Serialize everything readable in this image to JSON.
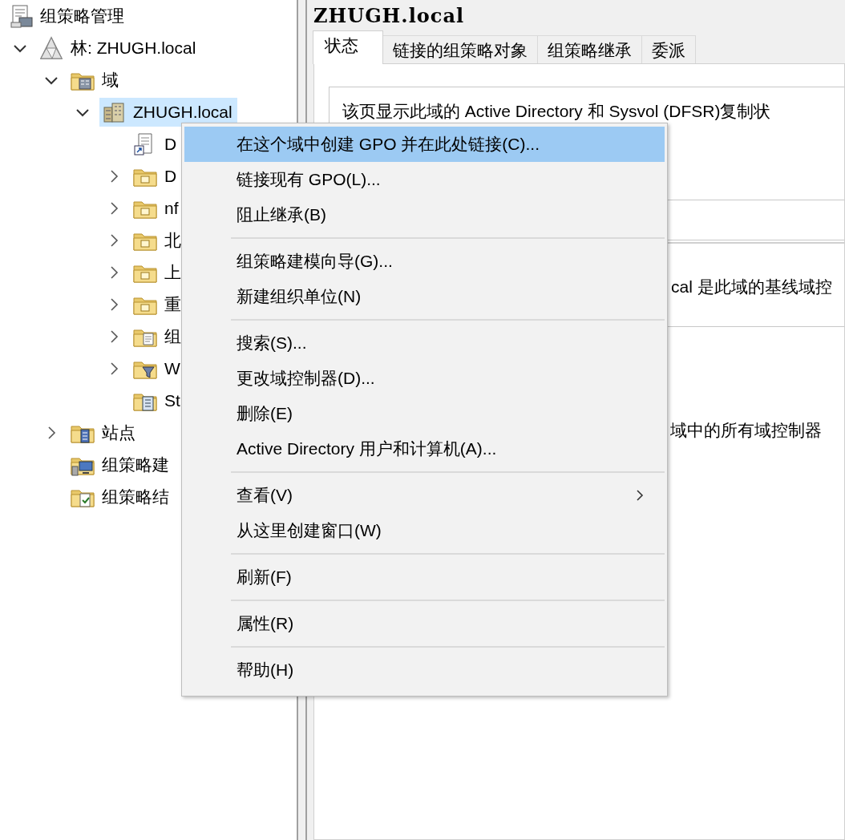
{
  "tree": [
    {
      "label": "组策略管理",
      "kind": "console",
      "selected": false,
      "children": [
        {
          "label": "林: ZHUGH.local",
          "kind": "forest",
          "expanded": true,
          "selected": false,
          "children": [
            {
              "label": "域",
              "kind": "domains",
              "expanded": true,
              "selected": false,
              "children": [
                {
                  "label": "ZHUGH.local",
                  "kind": "domain",
                  "expanded": true,
                  "selected": true,
                  "children": [
                    {
                      "label": "D",
                      "kind": "gpo-link",
                      "selected": false
                    },
                    {
                      "label": "D",
                      "kind": "ou",
                      "expanded": false,
                      "selected": false
                    },
                    {
                      "label": "nf",
                      "kind": "ou",
                      "expanded": false,
                      "selected": false
                    },
                    {
                      "label": "北",
                      "kind": "ou",
                      "expanded": false,
                      "selected": false
                    },
                    {
                      "label": "上",
                      "kind": "ou",
                      "expanded": false,
                      "selected": false
                    },
                    {
                      "label": "重",
                      "kind": "ou",
                      "expanded": false,
                      "selected": false
                    },
                    {
                      "label": "组",
                      "kind": "gpo-folder",
                      "expanded": false,
                      "selected": false
                    },
                    {
                      "label": "W",
                      "kind": "filter-folder",
                      "expanded": false,
                      "selected": false
                    },
                    {
                      "label": "St",
                      "kind": "starter-folder",
                      "selected": false
                    }
                  ]
                }
              ]
            },
            {
              "label": "站点",
              "kind": "sites",
              "expanded": false,
              "selected": false
            },
            {
              "label": "组策略建",
              "kind": "modeling",
              "selected": false
            },
            {
              "label": "组策略结",
              "kind": "results",
              "selected": false
            }
          ]
        }
      ]
    }
  ],
  "detail": {
    "title": "ZHUGH.local",
    "tabs": [
      {
        "label": "状态",
        "selected": true
      },
      {
        "label": "链接的组策略对象",
        "selected": false
      },
      {
        "label": "组策略继承",
        "selected": false
      },
      {
        "label": "委派",
        "selected": false
      }
    ],
    "intro": "该页显示此域的 Active Directory 和 Sysvol (DFSR)复制状",
    "baseline": "cal 是此域的基线域控",
    "all_dc": "域中的所有域控制器"
  },
  "context_menu": [
    {
      "kind": "item",
      "label": "在这个域中创建 GPO 并在此处链接(C)...",
      "selected": true
    },
    {
      "kind": "item",
      "label": "链接现有 GPO(L)...",
      "selected": false
    },
    {
      "kind": "item",
      "label": "阻止继承(B)",
      "selected": false
    },
    {
      "kind": "separator"
    },
    {
      "kind": "item",
      "label": "组策略建模向导(G)...",
      "selected": false
    },
    {
      "kind": "item",
      "label": "新建组织单位(N)",
      "selected": false
    },
    {
      "kind": "separator"
    },
    {
      "kind": "item",
      "label": "搜索(S)...",
      "selected": false
    },
    {
      "kind": "item",
      "label": "更改域控制器(D)...",
      "selected": false
    },
    {
      "kind": "item",
      "label": "删除(E)",
      "selected": false
    },
    {
      "kind": "item",
      "label": "Active Directory 用户和计算机(A)...",
      "selected": false
    },
    {
      "kind": "separator"
    },
    {
      "kind": "submenu",
      "label": "查看(V)",
      "selected": false
    },
    {
      "kind": "item",
      "label": "从这里创建窗口(W)",
      "selected": false
    },
    {
      "kind": "separator"
    },
    {
      "kind": "item",
      "label": "刷新(F)",
      "selected": false
    },
    {
      "kind": "separator"
    },
    {
      "kind": "item",
      "label": "属性(R)",
      "selected": false
    },
    {
      "kind": "separator"
    },
    {
      "kind": "item",
      "label": "帮助(H)",
      "selected": false
    }
  ]
}
